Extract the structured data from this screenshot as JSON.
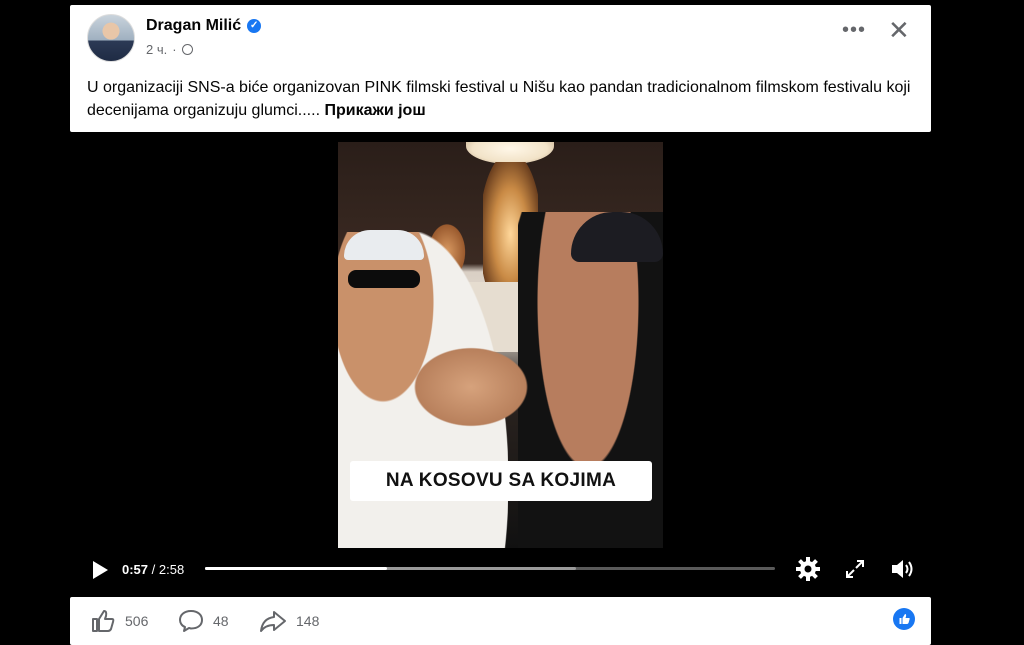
{
  "post": {
    "author": "Dragan Milić",
    "time": "2 ч.",
    "text": "U organizaciji SNS-a biće organizovan PINK filmski festival u Nišu kao pandan tradicionalnom filmskom festivalu koji decenijama organizuju glumci.....",
    "see_more": "Прикажи још"
  },
  "video": {
    "caption": "NA KOSOVU SA KOJIMA",
    "current_time": "0:57",
    "separator": " / ",
    "duration": "2:58",
    "progress_fraction": 0.32,
    "buffered_fraction": 0.65
  },
  "reactions": {
    "likes": "506",
    "comments": "48",
    "shares": "148"
  },
  "colors": {
    "accent": "#1877f2",
    "muted": "#65676b"
  },
  "icons": [
    "verified-badge-icon",
    "globe-icon",
    "more-options-icon",
    "close-icon",
    "play-icon",
    "settings-icon",
    "fullscreen-icon",
    "volume-icon",
    "like-icon",
    "comment-icon",
    "share-icon"
  ]
}
